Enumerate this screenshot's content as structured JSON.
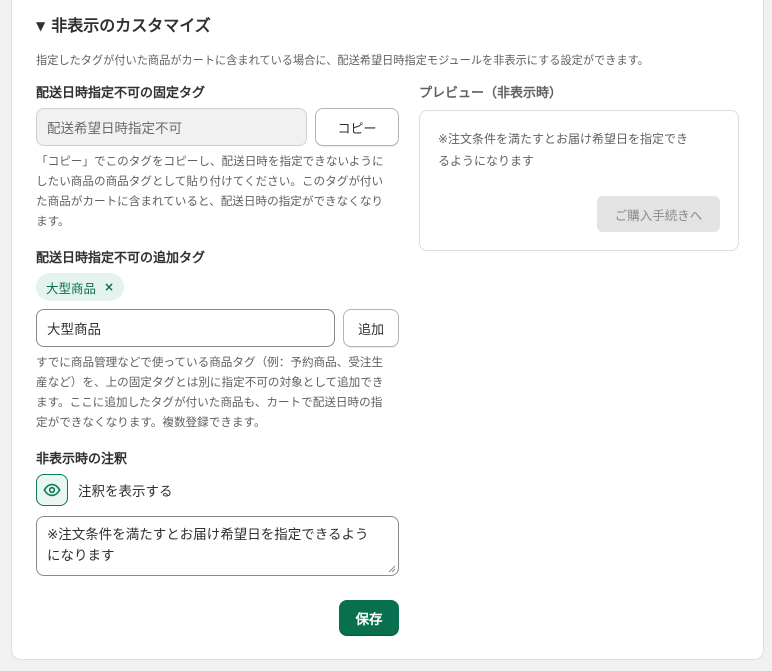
{
  "section": {
    "title": "非表示のカスタマイズ",
    "toggle_icon": "triangle-down-icon",
    "description": "指定したタグが付いた商品がカートに含まれている場合に、配送希望日時指定モジュールを非表示にする設定ができます。"
  },
  "fixed_tag": {
    "label": "配送日時指定不可の固定タグ",
    "value": "配送希望日時指定不可",
    "copy_button": "コピー",
    "help_lines": [
      "「コピー」でこのタグをコピーし、配送日時を指定できないように",
      "したい商品の商品タグとして貼り付けてください。このタグが付い",
      "た商品がカートに含まれていると、配送日時の指定ができなくなり",
      "ます。"
    ]
  },
  "additional_tags": {
    "label": "配送日時指定不可の追加タグ",
    "chips": [
      {
        "label": "大型商品",
        "remove": "×"
      }
    ],
    "input_value": "大型商品",
    "add_button": "追加",
    "help_lines": [
      "すでに商品管理などで使っている商品タグ（例：予約商品、受注生",
      "産など）を、上の固定タグとは別に指定不可の対象として追加でき",
      "ます。ここに追加したタグが付いた商品も、カートで配送日時の指",
      "定ができなくなります。複数登録できます。"
    ]
  },
  "note": {
    "label": "非表示時の注釈",
    "toggle_icon": "eye-icon",
    "toggle_label": "注釈を表示する",
    "text_lines": [
      "※注文条件を満たすとお届け希望日を指定できるよう",
      "になります"
    ]
  },
  "save_button": "保存",
  "preview": {
    "label": "プレビュー（非表示時）",
    "text_lines": [
      "※注文条件を満たすとお届け希望日を指定でき",
      "るようになります"
    ],
    "checkout_button": "ご購入手続きへ"
  },
  "colors": {
    "primary": "#08704e",
    "chip_bg": "#e4f3ec",
    "chip_text": "#0b6e4f"
  }
}
